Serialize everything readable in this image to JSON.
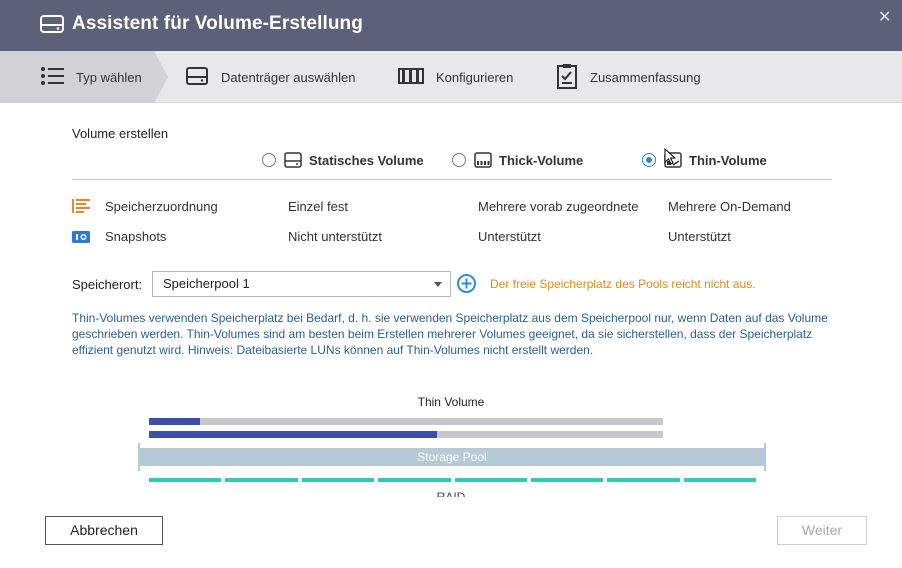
{
  "window": {
    "title": "Assistent für Volume-Erstellung",
    "close_glyph": "✕"
  },
  "steps": [
    {
      "label": "Typ wählen",
      "icon": "list-icon",
      "active": true
    },
    {
      "label": "Datenträger auswählen",
      "icon": "disk-icon",
      "active": false
    },
    {
      "label": "Konfigurieren",
      "icon": "configure-icon",
      "active": false
    },
    {
      "label": "Zusammenfassung",
      "icon": "clipboard-icon",
      "active": false
    }
  ],
  "create": {
    "section_label": "Volume erstellen",
    "options": [
      {
        "label": "Statisches Volume",
        "icon": "static-volume-icon",
        "checked": false
      },
      {
        "label": "Thick-Volume",
        "icon": "thick-volume-icon",
        "checked": false
      },
      {
        "label": "Thin-Volume",
        "icon": "thin-volume-icon",
        "checked": true
      }
    ]
  },
  "features": [
    {
      "label": "Speicherzuordnung",
      "icon": "allocation-icon",
      "values": [
        "Einzel fest",
        "Mehrere vorab zugeordnete",
        "Mehrere On-Demand"
      ]
    },
    {
      "label": "Snapshots",
      "icon": "snapshot-icon",
      "values": [
        "Nicht unterstützt",
        "Unterstützt",
        "Unterstützt"
      ]
    }
  ],
  "location": {
    "label": "Speicherort:",
    "selected": "Speicherpool 1",
    "warning": "Der freie Speicherplatz des Pools reicht nicht aus."
  },
  "description": "Thin-Volumes verwenden Speicherplatz bei Bedarf, d. h. sie verwenden Speicherplatz aus dem Speicherpool nur, wenn Daten auf das Volume geschrieben werden. Thin-Volumes sind am besten beim Erstellen mehrerer Volumes geeignet, da sie sicherstellen, dass der Speicherplatz effizient genutzt wird. Hinweis: Dateibasierte LUNs können auf Thin-Volumes nicht erstellt werden.",
  "visual": {
    "title": "Thin Volume",
    "volume_usage": [
      0.1,
      0.56
    ],
    "pool_label": "Storage Pool",
    "disk_count": 8,
    "raid_label": "RAID"
  },
  "colors": {
    "titlebar": "#5b6178",
    "accent_blue": "#3a7fd0",
    "volume_fill": "#3b4eaa",
    "pool": "#b6c9d7",
    "disk": "#34c9b5",
    "warning": "#e08a1e",
    "description": "#2a5f8f"
  },
  "buttons": {
    "cancel": "Abbrechen",
    "next": "Weiter"
  }
}
